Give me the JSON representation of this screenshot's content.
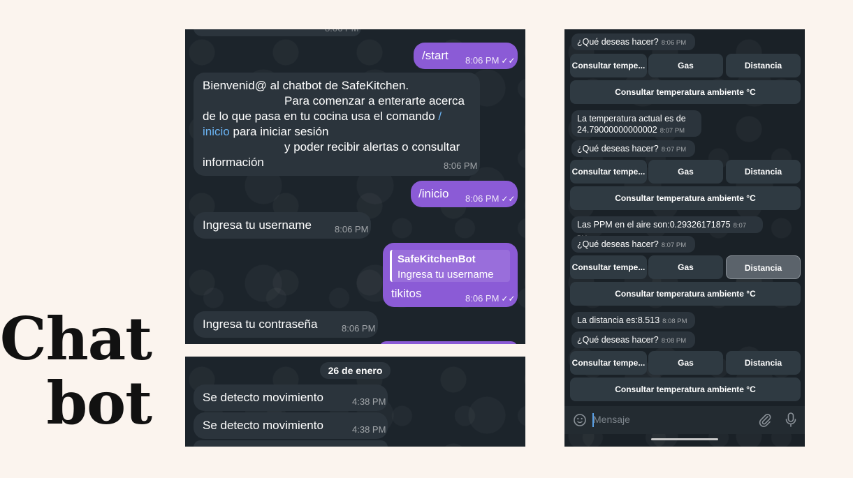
{
  "title": {
    "line1": "Chat",
    "line2": "bot"
  },
  "panel_top": {
    "partial_time": "8:06 PM",
    "messages": [
      {
        "text": "/start",
        "time": "8:06 PM",
        "ticks": "✓✓"
      },
      {
        "line1": "Bienvenid@ al chatbot de SafeKitchen.",
        "line2": "Para comenzar a enterarte acerca",
        "line3": "de lo que pasa en tu cocina usa el comando",
        "cmd1": "/",
        "cmd2": "inicio",
        "line4": "para iniciar sesión",
        "line5": "y poder recibir alertas o consultar",
        "line6": "información",
        "time": "8:06 PM"
      },
      {
        "text": "/inicio",
        "time": "8:06 PM",
        "ticks": "✓✓"
      },
      {
        "text": "Ingresa tu username",
        "time": "8:06 PM"
      },
      {
        "quote_name": "SafeKitchenBot",
        "quote_text": "Ingresa tu username",
        "text": "tikitos",
        "time": "8:06 PM",
        "ticks": "✓✓"
      },
      {
        "text": "Ingresa tu contraseña",
        "time": "8:06 PM"
      }
    ]
  },
  "panel_bottom": {
    "date": "26 de enero",
    "messages": [
      {
        "text": "Se detecto movimiento",
        "time": "4:38 PM"
      },
      {
        "text": "Se detecto movimiento",
        "time": "4:38 PM"
      }
    ]
  },
  "panel_right": {
    "question": "¿Qué deseas hacer?",
    "buttons": {
      "temp": "Consultar tempe...",
      "gas": "Gas",
      "dist": "Distancia",
      "ambient": "Consultar temperatura ambiente °C"
    },
    "t806": "8:06 PM",
    "t807": "8:07 PM",
    "t808": "8:08 PM",
    "temp_line1": "La temperatura actual es de",
    "temp_line2": "24.79000000000002",
    "ppm": "Las PPM en el aire son:0.29326171875",
    "distance": "La distancia es:8.513",
    "input_placeholder": "Mensaje",
    "emoji_icon": "emoji-icon",
    "attach_icon": "paperclip-icon",
    "mic_icon": "microphone-icon"
  }
}
